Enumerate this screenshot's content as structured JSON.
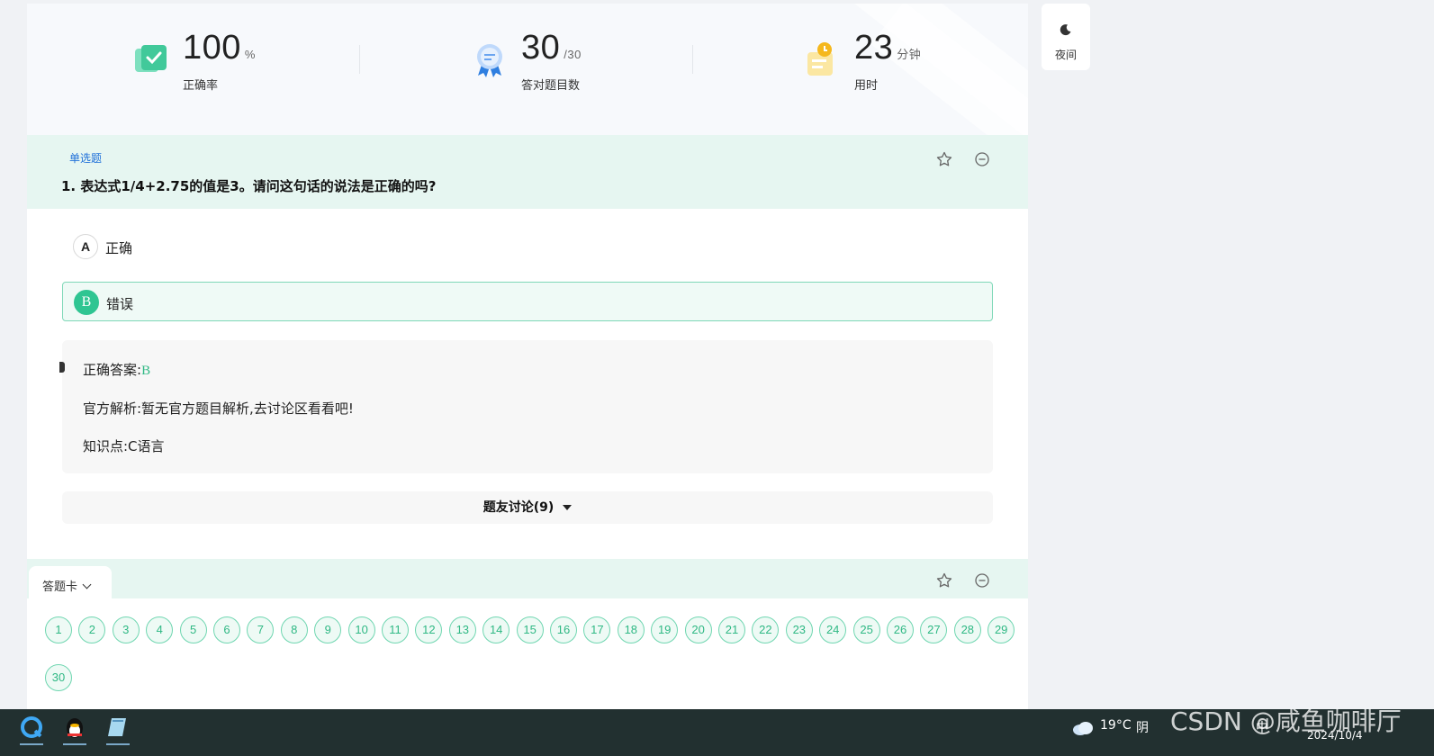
{
  "stats": [
    {
      "value": "100",
      "unit": "%",
      "label": "正确率",
      "icon": "check-badge-icon"
    },
    {
      "value": "30",
      "unit": "/30",
      "label": "答对题目数",
      "icon": "award-ribbon-icon"
    },
    {
      "value": "23",
      "unit": "分钟",
      "label": "用时",
      "icon": "clock-clipboard-icon"
    }
  ],
  "question": {
    "type": "单选题",
    "title": "1. 表达式1/4+2.75的值是3。请问这句话的说法是正确的吗?",
    "options": [
      {
        "letter": "A",
        "text": "正确",
        "selected": false
      },
      {
        "letter": "B",
        "text": "错误",
        "selected": true
      }
    ]
  },
  "analysis": {
    "answer_label": "正确答案:",
    "answer_value": "B",
    "official": "官方解析:暂无官方题目解析,去讨论区看看吧!",
    "knowledge": "知识点:C语言"
  },
  "discussion": {
    "label": "题友讨论(9)"
  },
  "answer_card": {
    "tab_label": "答题卡",
    "numbers": [
      "1",
      "2",
      "3",
      "4",
      "5",
      "6",
      "7",
      "8",
      "9",
      "10",
      "11",
      "12",
      "13",
      "14",
      "15",
      "16",
      "17",
      "18",
      "19",
      "20",
      "21",
      "22",
      "23",
      "24",
      "25",
      "26",
      "27",
      "28",
      "29",
      "30"
    ]
  },
  "night_mode": {
    "label": "夜间"
  },
  "taskbar": {
    "weather": "19°C",
    "weather_desc": "阴",
    "ime": "中",
    "date": "2024/10/4",
    "watermark": "CSDN @咸鱼咖啡厅"
  },
  "colors": {
    "accent": "#2fc592",
    "header_bg": "#e6f6f1",
    "link_blue": "#1e6fd9"
  }
}
